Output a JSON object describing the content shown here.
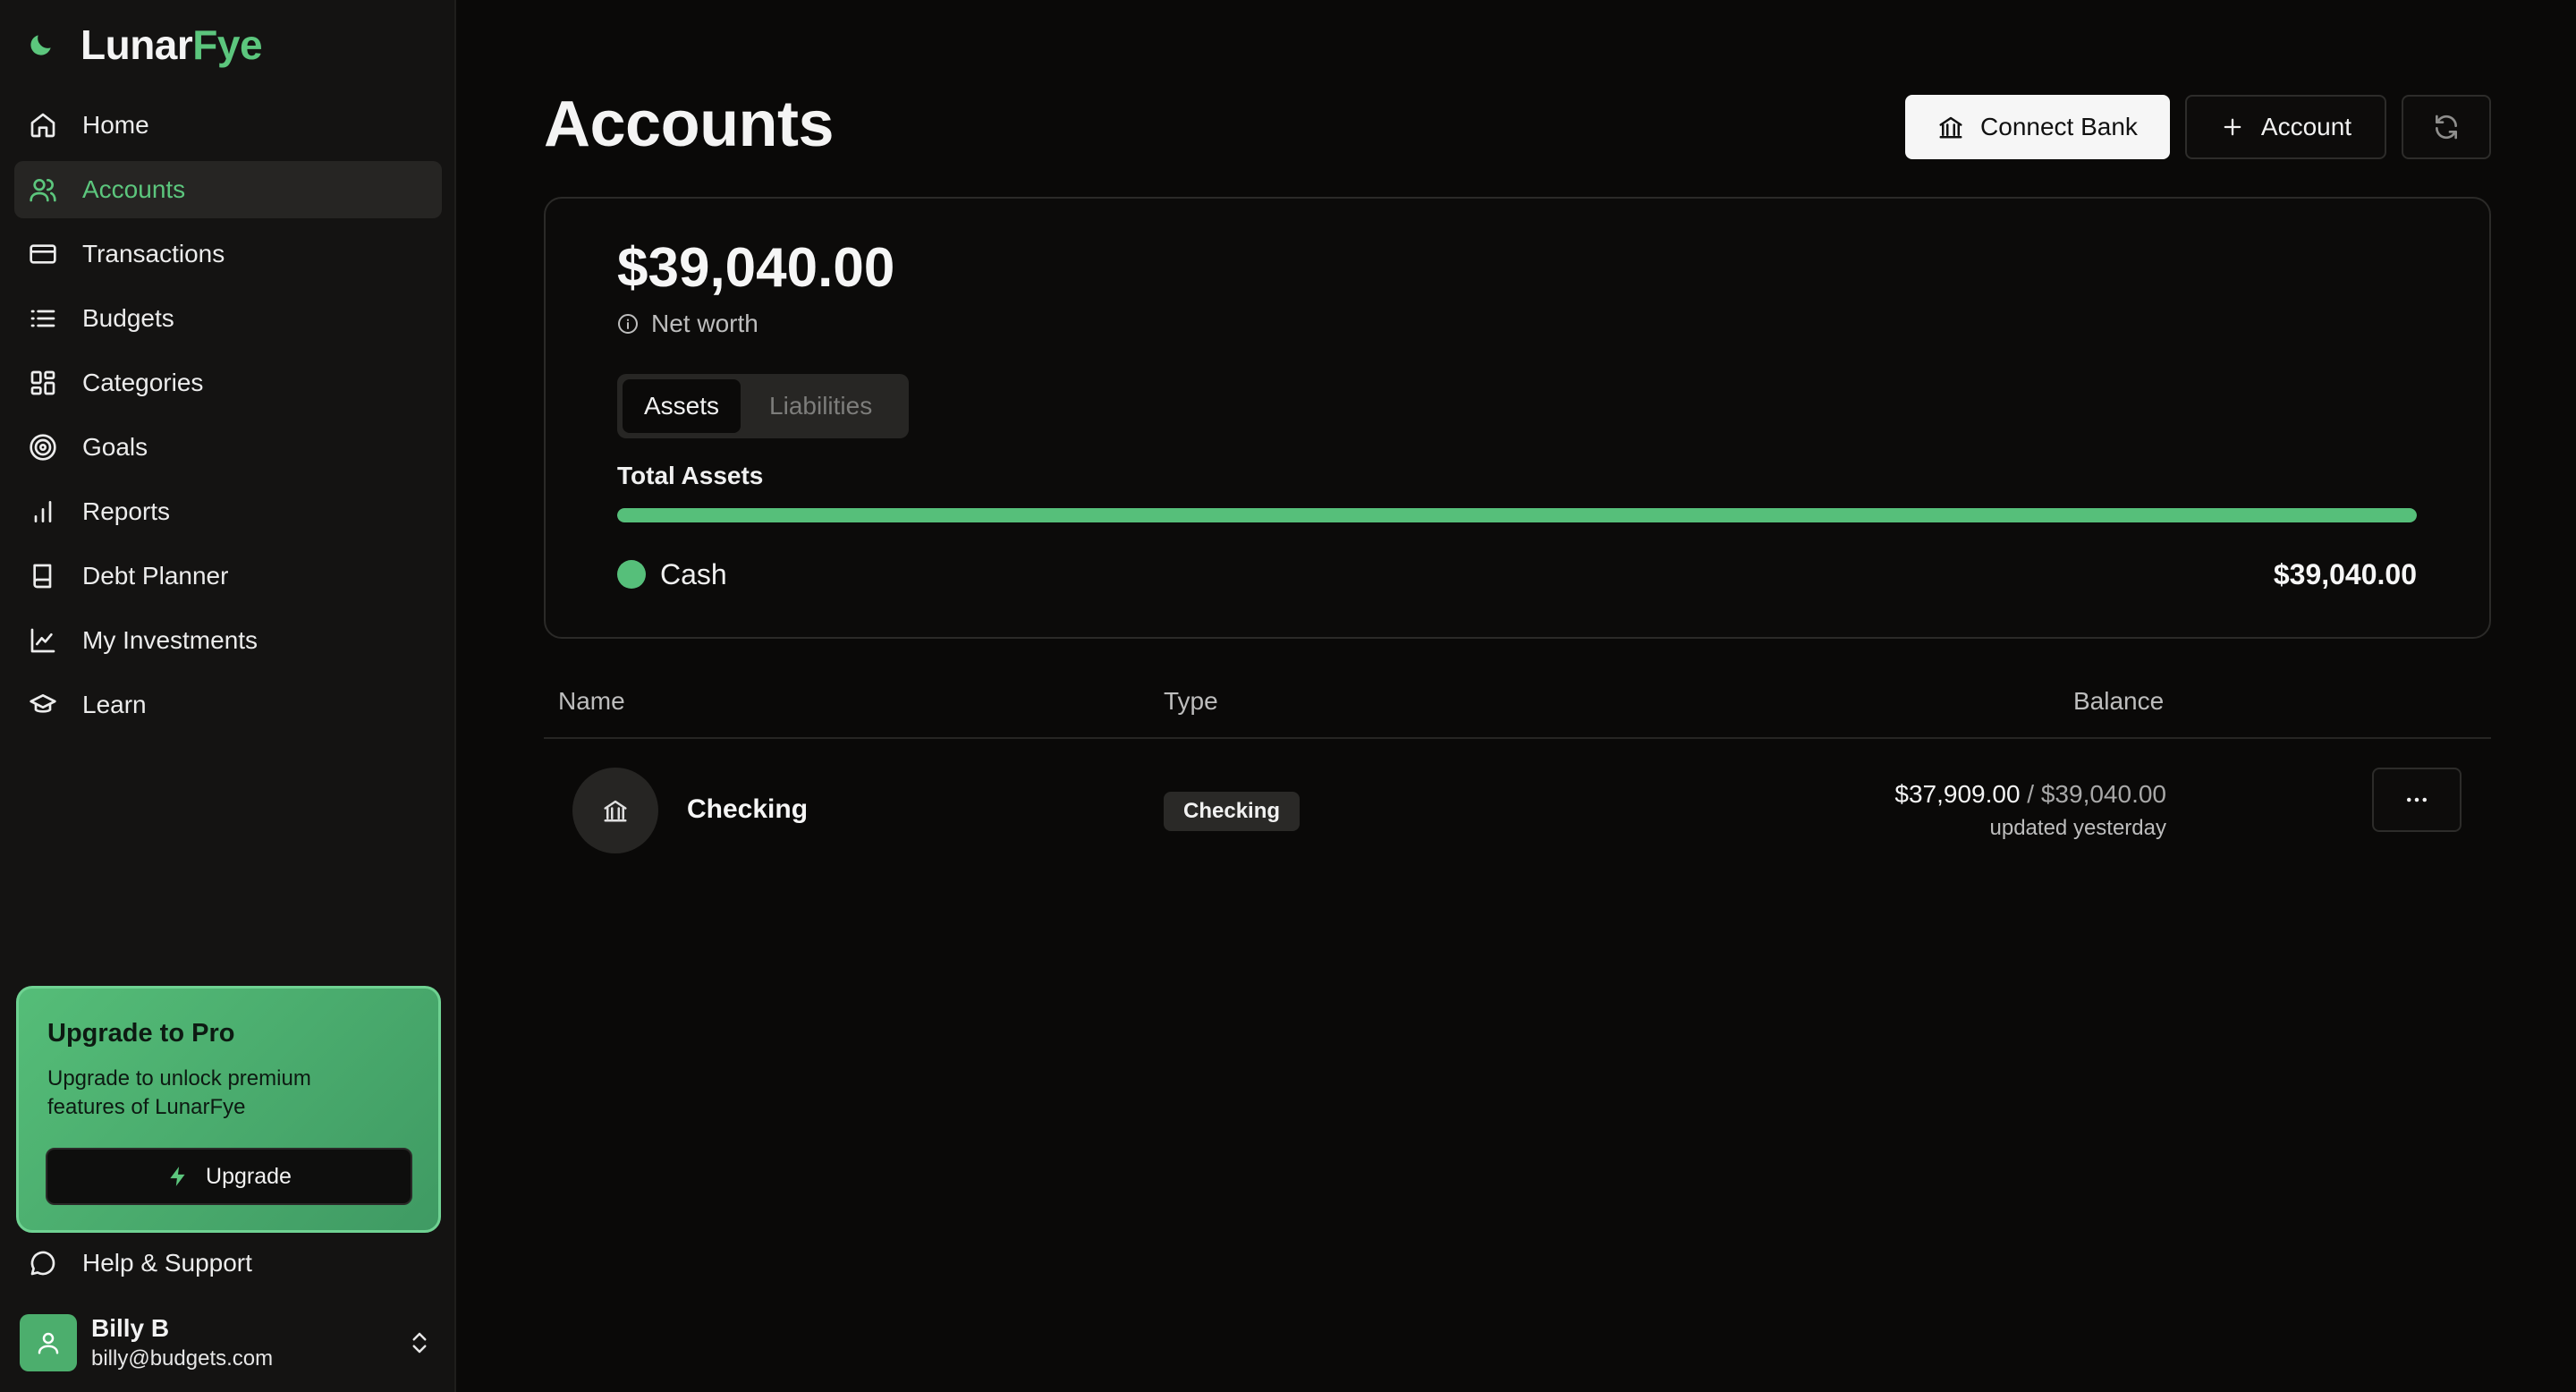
{
  "brand": {
    "name_part1": "Lunar",
    "name_part2": "Fye",
    "accent": "#5cc67d"
  },
  "sidebar": {
    "items": [
      {
        "label": "Home",
        "icon": "home-icon",
        "active": false
      },
      {
        "label": "Accounts",
        "icon": "users-icon",
        "active": true
      },
      {
        "label": "Transactions",
        "icon": "credit-card-icon",
        "active": false
      },
      {
        "label": "Budgets",
        "icon": "list-icon",
        "active": false
      },
      {
        "label": "Categories",
        "icon": "grid-icon",
        "active": false
      },
      {
        "label": "Goals",
        "icon": "target-icon",
        "active": false
      },
      {
        "label": "Reports",
        "icon": "bar-chart-icon",
        "active": false
      },
      {
        "label": "Debt Planner",
        "icon": "book-icon",
        "active": false
      },
      {
        "label": "My Investments",
        "icon": "line-chart-icon",
        "active": false
      },
      {
        "label": "Learn",
        "icon": "graduation-cap-icon",
        "active": false
      }
    ],
    "promo": {
      "title": "Upgrade to Pro",
      "text": "Upgrade to unlock premium features of LunarFye",
      "button_label": "Upgrade"
    },
    "help_label": "Help & Support",
    "user": {
      "name": "Billy B",
      "email": "billy@budgets.com"
    }
  },
  "header": {
    "title": "Accounts",
    "connect_bank_label": "Connect Bank",
    "add_account_label": "Account"
  },
  "summary": {
    "net_worth": "$39,040.00",
    "net_worth_label": "Net worth",
    "tabs": [
      {
        "label": "Assets",
        "selected": true
      },
      {
        "label": "Liabilities",
        "selected": false
      }
    ],
    "total_label": "Total Assets",
    "cash_fraction": 1.0,
    "legend": [
      {
        "label": "Cash",
        "value": "$39,040.00",
        "color": "#56bf7a"
      }
    ]
  },
  "table": {
    "columns": {
      "name": "Name",
      "type": "Type",
      "balance": "Balance"
    },
    "rows": [
      {
        "name": "Checking",
        "type": "Checking",
        "balance": "$37,909.00",
        "separator": " / ",
        "limit": "$39,040.00",
        "updated": "updated yesterday",
        "icon": "bank-icon"
      }
    ]
  }
}
